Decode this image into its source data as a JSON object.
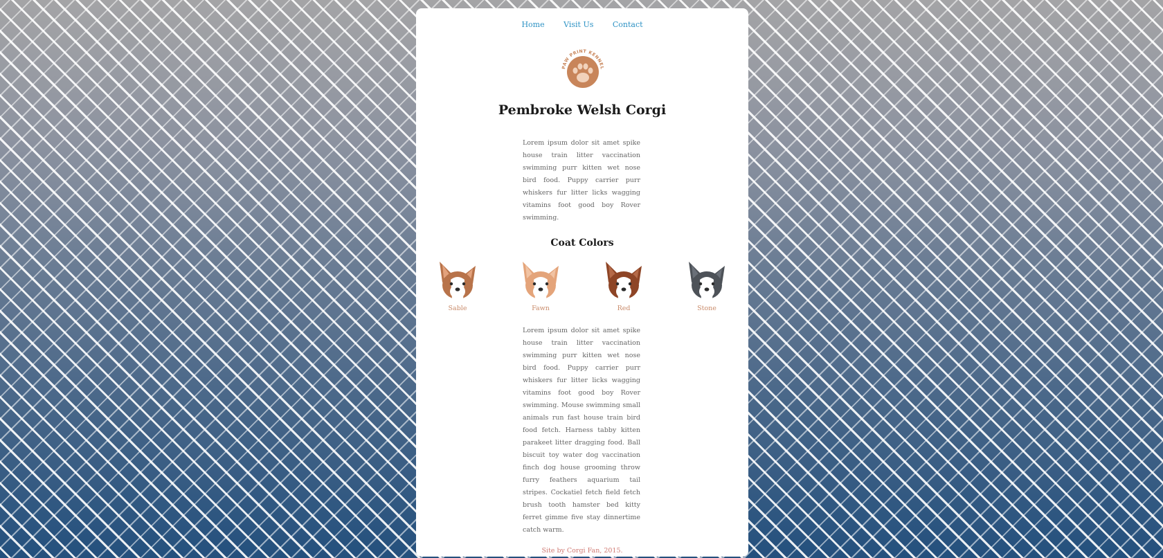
{
  "nav": {
    "items": [
      "Home",
      "Visit Us",
      "Contact"
    ]
  },
  "logo": {
    "text": "PAW PRINT KENNELS",
    "color": "#c8855a"
  },
  "page": {
    "title": "Pembroke Welsh Corgi"
  },
  "intro": "Lorem ipsum dolor sit amet spike house train litter vaccination swimming purr kitten wet nose bird food. Puppy carrier purr whiskers fur litter licks wagging vitamins foot good boy Rover swimming.",
  "coat_section": {
    "title": "Coat Colors",
    "colors": [
      {
        "name": "Sable",
        "fur": "#b8734a",
        "ear": "#e3a27c"
      },
      {
        "name": "Fawn",
        "fur": "#e4a47a",
        "ear": "#f1c3a3"
      },
      {
        "name": "Red",
        "fur": "#8e4526",
        "ear": "#b56a48"
      },
      {
        "name": "Stone",
        "fur": "#4d5258",
        "ear": "#6a7078"
      }
    ]
  },
  "body": "Lorem ipsum dolor sit amet spike house train litter vaccination swimming purr kitten wet nose bird food. Puppy carrier purr whiskers fur litter licks wagging vitamins foot good boy Rover swimming. Mouse swimming small animals run fast house train bird food fetch. Harness tabby kitten parakeet litter dragging food. Ball biscuit toy water dog vaccination finch dog house grooming throw furry feathers aquarium tail stripes. Cockatiel fetch field fetch brush tooth hamster bed kitty ferret gimme five stay dinnertime catch warm.",
  "footer": "Site by Corgi Fan, 2015."
}
